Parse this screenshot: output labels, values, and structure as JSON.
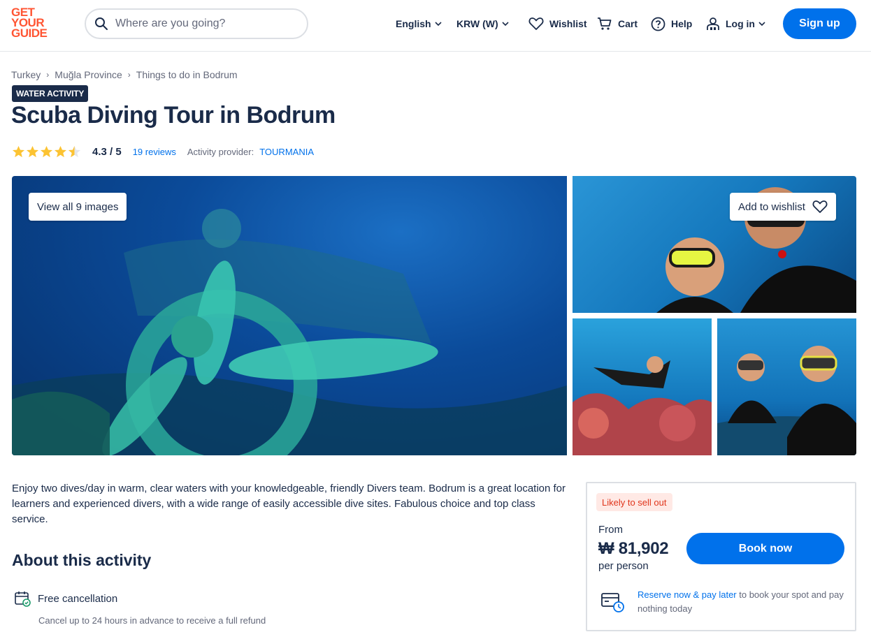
{
  "header": {
    "logo": [
      "GET",
      "YOUR",
      "GUIDE"
    ],
    "search_placeholder": "Where are you going?",
    "language": "English",
    "currency": "KRW (W)",
    "wishlist": "Wishlist",
    "cart": "Cart",
    "help": "Help",
    "login": "Log in",
    "signup": "Sign up"
  },
  "breadcrumb": [
    "Turkey",
    "Muğla Province",
    "Things to do in Bodrum"
  ],
  "badge": "WATER ACTIVITY",
  "title": "Scuba Diving Tour in Bodrum",
  "rating": {
    "stars": 4.3,
    "value": "4.3 / 5",
    "reviews": "19 reviews",
    "provider_label": "Activity provider:",
    "provider": "TOURMANIA"
  },
  "gallery": {
    "view_all": "View all 9 images",
    "add_wishlist": "Add to wishlist"
  },
  "description": "Enjoy two dives/day in warm, clear waters with your knowledgeable, friendly Divers team. Bodrum is a great location for learners and experienced divers, with a wide range of easily accessible dive sites. Fabulous choice and top class service.",
  "about": {
    "title": "About this activity",
    "features": [
      {
        "title": "Free cancellation",
        "subtitle": "Cancel up to 24 hours in advance to receive a full refund"
      }
    ]
  },
  "booking": {
    "badge": "Likely to sell out",
    "from": "From",
    "price": "₩ 81,902",
    "per": "per person",
    "button": "Book now",
    "reserve_link": "Reserve now & pay later",
    "reserve_rest": " to book your spot and pay nothing today"
  },
  "colors": {
    "brand": "#ff5533",
    "primary": "#0071eb",
    "text": "#1a2b49",
    "muted": "#63687a",
    "star": "#fcc332"
  }
}
